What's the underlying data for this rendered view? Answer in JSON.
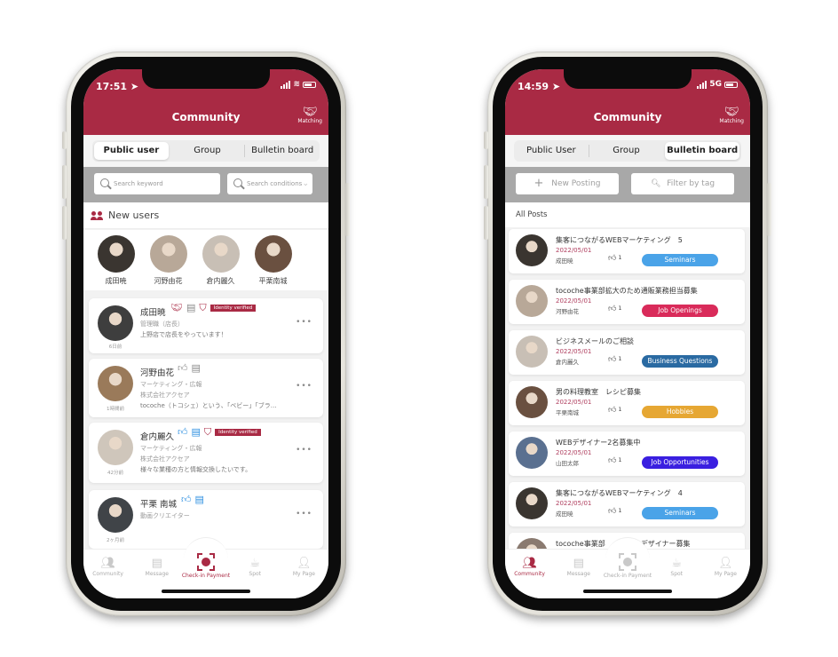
{
  "colors": {
    "brand": "#a92a44",
    "seminars": "#4aa3e8",
    "job_openings": "#d92b5a",
    "business_questions": "#2a6aa2",
    "hobbies": "#e6a733",
    "job_opportunities": "#3a1fe0"
  },
  "left_phone": {
    "status": {
      "time": "17:51 ➤",
      "network": ""
    },
    "header": {
      "title": "Community",
      "matching_label": "Matching"
    },
    "tabs": [
      {
        "label": "Public user",
        "active": true
      },
      {
        "label": "Group",
        "active": false
      },
      {
        "label": "Bulletin board",
        "active": false
      }
    ],
    "search": {
      "keyword_placeholder": "Search keyword",
      "conditions_placeholder": "Search conditions"
    },
    "new_users": {
      "title": "New users",
      "users": [
        {
          "name": "成田暁",
          "color": "#3a3530"
        },
        {
          "name": "河野由花",
          "color": "#b8a898"
        },
        {
          "name": "倉内麗久",
          "color": "#c8bfb5"
        },
        {
          "name": "平栗南城",
          "color": "#6a5040"
        }
      ]
    },
    "users": [
      {
        "name": "成田暁",
        "ago": "6日前",
        "lines": [
          "管理職（店長）",
          "上野店で店長をやっています！"
        ],
        "verified": "Identity verified",
        "icons": [
          "handshake-icon",
          "message-blocked-icon",
          "shield-icon"
        ],
        "color": "#3e3e3e"
      },
      {
        "name": "河野由花",
        "ago": "1時間前",
        "lines": [
          "マーケティング・広報",
          "株式会社アクセア",
          "tocoche（トコシェ）という、「ベビー」「ブラ…"
        ],
        "verified": "",
        "icons": [
          "like-blocked-icon",
          "message-blocked-icon"
        ],
        "color": "#9a7a5a"
      },
      {
        "name": "倉内麗久",
        "ago": "42分前",
        "lines": [
          "マーケティング・広報",
          "株式会社アクセア",
          "様々な業種の方と情報交換したいです。"
        ],
        "verified": "Identity verified",
        "icons": [
          "like-icon",
          "message-icon",
          "shield-icon"
        ],
        "color": "#cfc6bb"
      },
      {
        "name": "平栗 南城",
        "ago": "2ヶ月前",
        "lines": [
          "動画クリエイター"
        ],
        "verified": "",
        "icons": [
          "like-pending-icon",
          "message-icon"
        ],
        "color": "#404448"
      }
    ],
    "more_label": "•••",
    "tabbar": [
      {
        "label": "Community",
        "active": false
      },
      {
        "label": "Message",
        "active": false
      },
      {
        "label": "Check-in Payment",
        "active": true
      },
      {
        "label": "Spot",
        "active": false
      },
      {
        "label": "My Page",
        "active": false
      }
    ]
  },
  "right_phone": {
    "status": {
      "time": "14:59 ➤",
      "network": "5G"
    },
    "header": {
      "title": "Community",
      "matching_label": "Matching"
    },
    "tabs": [
      {
        "label": "Public User",
        "active": false
      },
      {
        "label": "Group",
        "active": false
      },
      {
        "label": "Bulletin board",
        "active": true
      }
    ],
    "actions": {
      "new_posting": "New Posting",
      "filter_by_tag": "Filter by tag"
    },
    "all_posts_label": "All Posts",
    "posts": [
      {
        "title": "集客につながるWEBマーケティング　5",
        "date": "2022/05/01",
        "author": "成田暁",
        "likes": "1",
        "tag": "Seminars",
        "tag_color": "#4aa3e8",
        "color": "#3a3530"
      },
      {
        "title": "tocoche事業部拡大のため通販業務担当募集",
        "date": "2022/05/01",
        "author": "河野由花",
        "likes": "1",
        "tag": "Job Openings",
        "tag_color": "#d92b5a",
        "color": "#b8a898"
      },
      {
        "title": "ビジネスメールのご相談",
        "date": "2022/05/01",
        "author": "倉内麗久",
        "likes": "1",
        "tag": "Business Questions",
        "tag_color": "#2a6aa2",
        "color": "#c8bfb5"
      },
      {
        "title": "男の料理教室　レシピ募集",
        "date": "2022/05/01",
        "author": "平栗南城",
        "likes": "1",
        "tag": "Hobbies",
        "tag_color": "#e6a733",
        "color": "#6a5040"
      },
      {
        "title": "WEBデザイナー2名募集中",
        "date": "2022/05/01",
        "author": "山田太郎",
        "likes": "1",
        "tag": "Job Opportunities",
        "tag_color": "#3a1fe0",
        "color": "#5a7090"
      },
      {
        "title": "集客につながるWEBマーケティング　4",
        "date": "2022/05/01",
        "author": "成田暁",
        "likes": "1",
        "tag": "Seminars",
        "tag_color": "#4aa3e8",
        "color": "#3a3530"
      },
      {
        "title": "tocoche事業部　　　　　デザイナー募集",
        "date": "",
        "author": "",
        "likes": "",
        "tag": "",
        "tag_color": "",
        "color": "#8a7a70"
      }
    ],
    "tabbar": [
      {
        "label": "Community",
        "active": true
      },
      {
        "label": "Message",
        "active": false
      },
      {
        "label": "Check-in Payment",
        "active": false
      },
      {
        "label": "Spot",
        "active": false
      },
      {
        "label": "My Page",
        "active": false
      }
    ]
  }
}
